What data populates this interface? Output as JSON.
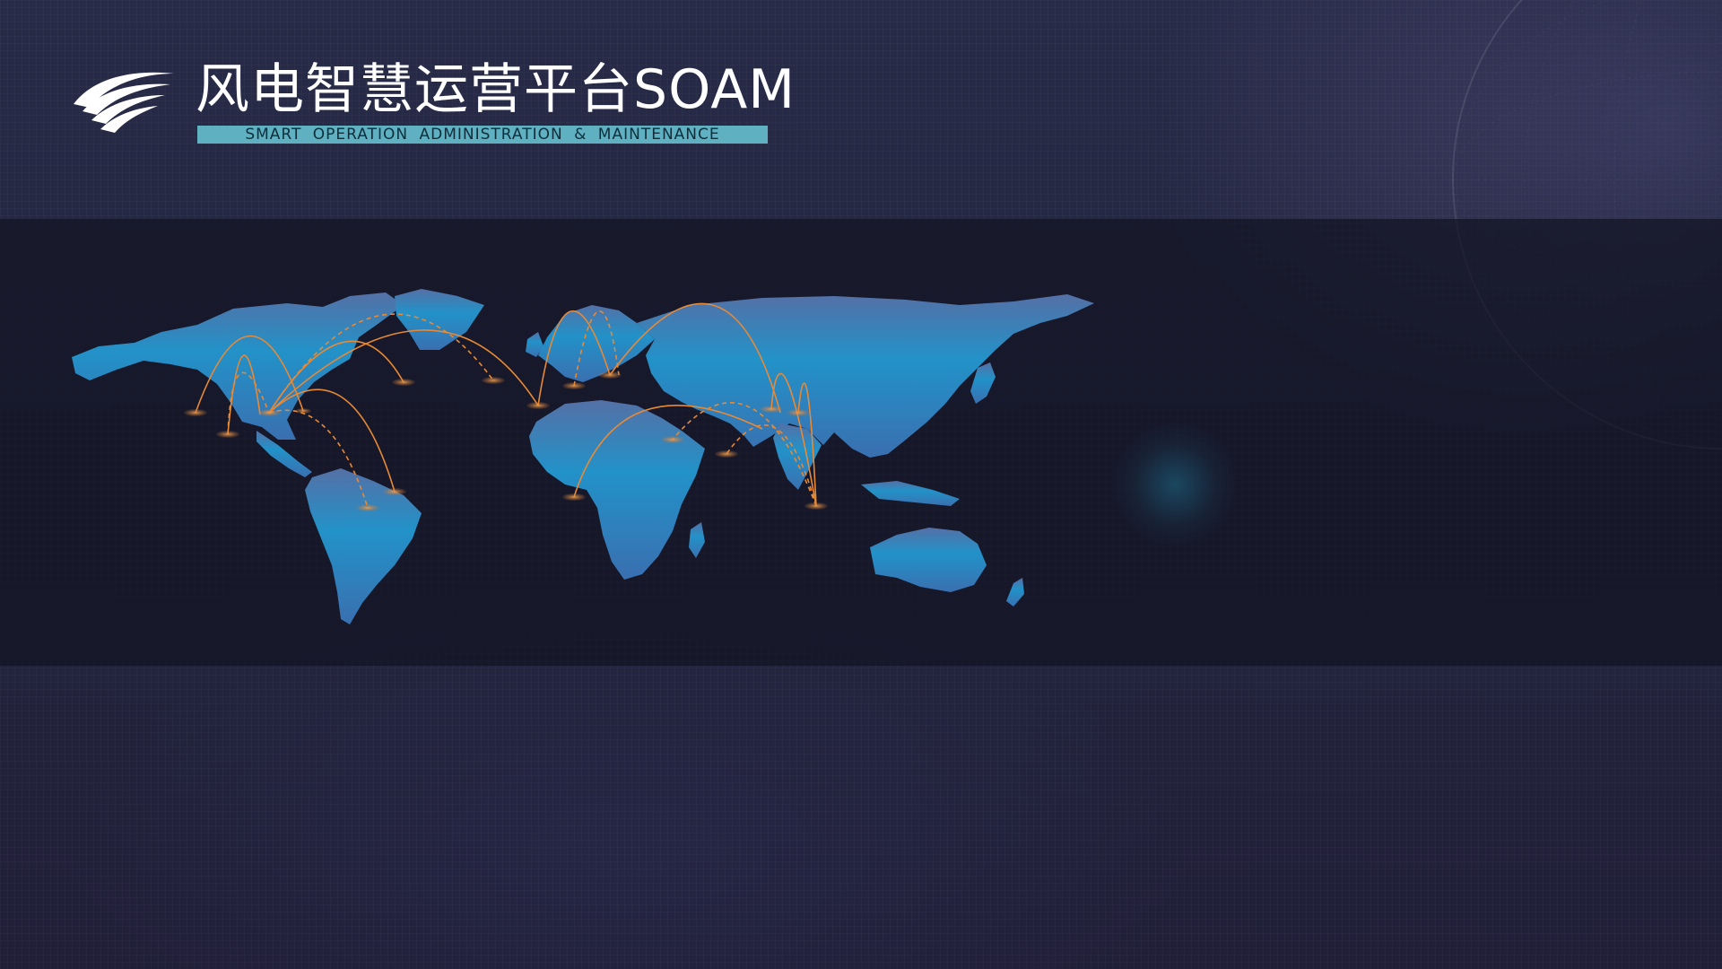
{
  "header": {
    "title": "风电智慧运营平台SOAM",
    "subtitle": "SMART OPERATION ADMINISTRATION & MAINTENANCE"
  },
  "colors": {
    "accent": "#5fb0c1",
    "map_fill_top": "#4f6fa8",
    "map_fill_bottom": "#1a9fd0",
    "route": "#e88a35",
    "background": "#23263f"
  },
  "icons": {
    "logo": "wind-swoosh-logo",
    "map": "world-map-routes",
    "globe": "dotted-globe"
  }
}
